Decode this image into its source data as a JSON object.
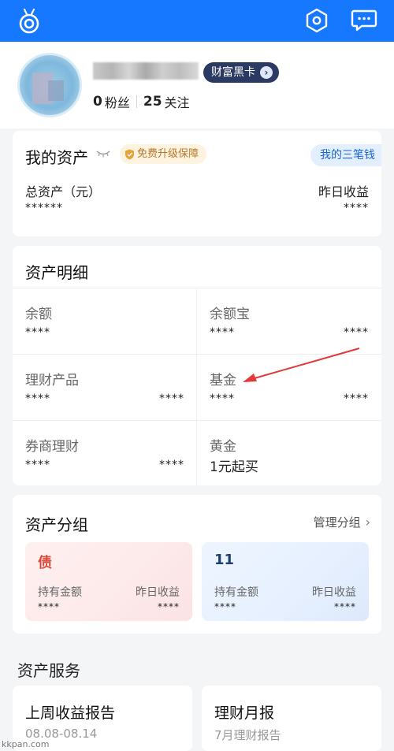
{
  "topbar": {
    "logo_icon": "alipay-mascot-icon",
    "settings_icon": "hexagon-settings-icon",
    "message_icon": "chat-bubble-icon",
    "background": "#1677ff"
  },
  "profile": {
    "vip_label": "财富黑卡",
    "fans_count": "0",
    "fans_label": "粉丝",
    "follow_count": "25",
    "follow_label": "关注"
  },
  "my_assets": {
    "title": "我的资产",
    "upgrade_badge": "免费升级保障",
    "three_money_label": "我的三笔钱",
    "total_label": "总资产（元）",
    "total_value": "******",
    "yesterday_label": "昨日收益",
    "yesterday_value": "****"
  },
  "asset_detail": {
    "title": "资产明细",
    "cells": [
      {
        "label": "余额",
        "left": "****",
        "right": ""
      },
      {
        "label": "余额宝",
        "left": "****",
        "right": "****"
      },
      {
        "label": "理财产品",
        "left": "****",
        "right": "****"
      },
      {
        "label": "基金",
        "left": "****",
        "right": "****"
      },
      {
        "label": "券商理财",
        "left": "****",
        "right": "****"
      },
      {
        "label": "黄金",
        "big": "1元起买"
      }
    ]
  },
  "asset_group": {
    "title": "资产分组",
    "manage_label": "管理分组",
    "groups": [
      {
        "name": "债",
        "hold_label": "持有金额",
        "hold_value": "****",
        "yday_label": "昨日收益",
        "yday_value": "****",
        "accent": "#d94b3a"
      },
      {
        "name": "11",
        "hold_label": "持有金额",
        "hold_value": "****",
        "yday_label": "昨日收益",
        "yday_value": "****",
        "accent": "#1f3e70"
      }
    ]
  },
  "services": {
    "title": "资产服务",
    "cards": [
      {
        "title": "上周收益报告",
        "subtitle": "08.08-08.14"
      },
      {
        "title": "理财月报",
        "subtitle": "7月理财报告"
      }
    ]
  },
  "watermark": "kkpan.com"
}
